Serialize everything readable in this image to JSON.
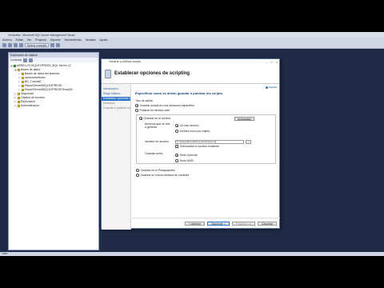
{
  "ssms": {
    "title": "Ventanilla - Microsoft SQL Server Management Studio",
    "menu": [
      "Archivo",
      "Editar",
      "Ver",
      "Proyecto",
      "Depurar",
      "Herramientas",
      "Ventana",
      "Ayuda"
    ],
    "new_query": "Nueva consulta",
    "status": "Listo"
  },
  "explorer": {
    "title": "Explorador de objetos",
    "connect": "Conectar",
    "tree": [
      {
        "label": "ABREU-PC\\SQLEXPRESS (SQL Server 12",
        "level": 0,
        "expanded": true,
        "type": "server"
      },
      {
        "label": "Bases de datos",
        "level": 1,
        "expanded": true,
        "type": "folder"
      },
      {
        "label": "Bases de datos del sistema",
        "level": 2,
        "expanded": false,
        "type": "folder"
      },
      {
        "label": "AdventureWorks",
        "level": 2,
        "expanded": false,
        "type": "db"
      },
      {
        "label": "BD_Tutorial2",
        "level": 2,
        "expanded": false,
        "type": "db"
      },
      {
        "label": "ReportServer$SQLEXPRESS",
        "level": 2,
        "expanded": false,
        "type": "db"
      },
      {
        "label": "ReportServer$SQLEXPRESSTempDB",
        "level": 2,
        "expanded": false,
        "type": "db"
      },
      {
        "label": "Seguridad",
        "level": 1,
        "expanded": false,
        "type": "folder"
      },
      {
        "label": "Objetos de servidor",
        "level": 1,
        "expanded": false,
        "type": "folder"
      },
      {
        "label": "Replicación",
        "level": 1,
        "expanded": false,
        "type": "folder"
      },
      {
        "label": "Administración",
        "level": 1,
        "expanded": false,
        "type": "folder"
      }
    ]
  },
  "dialog": {
    "window_title": "Generar y publicar scripts",
    "heading": "Establecer opciones de scripting",
    "help": "Ayuda",
    "nav": [
      {
        "label": "Introducción",
        "state": "link"
      },
      {
        "label": "Elegir objetos",
        "state": "link"
      },
      {
        "label": "Establecer opciones de scripting",
        "state": "active"
      },
      {
        "label": "Resumen",
        "state": "muted"
      },
      {
        "label": "Guardar o publicar scripts",
        "state": "muted"
      }
    ],
    "instruction": "Especificar cómo se deben guardar o publicar los scripts.",
    "output_type_label": "Tipo de salida",
    "output_options": [
      {
        "label": "Guardar scripts en una ubicación específica",
        "selected": true
      },
      {
        "label": "Publicar en servicio web",
        "selected": false
      }
    ],
    "save_to_file": "Guardar en el archivo",
    "advanced_button": "Avanzadas",
    "files_to_generate_label": "Archivos que se van a generar",
    "file_options": [
      {
        "label": "Un solo archivo",
        "selected": true
      },
      {
        "label": "Archivo único por objeto",
        "selected": false
      }
    ],
    "filename_label": "Nombre de archivo:",
    "filename_value": "C:\\Users\\Abreu\\Documents\\script.sql",
    "browse": "...",
    "overwrite_label": "Sobrescribir el archivo existente",
    "save_as_label": "Guardar como:",
    "save_as_options": [
      {
        "label": "Texto Unicode",
        "selected": true
      },
      {
        "label": "Texto ANSI",
        "selected": false
      }
    ],
    "clipboard": "Guardar en el Portapapeles",
    "new_query_window": "Guardar en nueva ventana de consulta",
    "buttons": {
      "previous": "< Anterior",
      "next": "Siguiente >",
      "finish": "Finalizar >>|",
      "cancel": "Cancelar"
    }
  }
}
